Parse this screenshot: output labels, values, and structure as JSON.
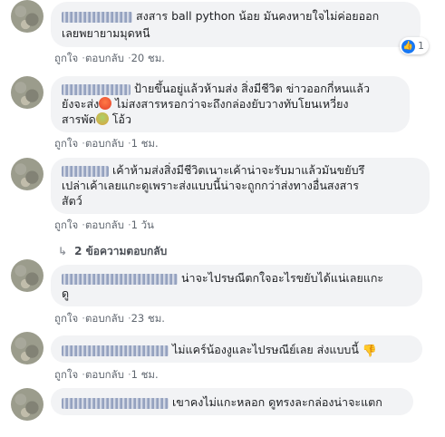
{
  "comments": [
    {
      "text_line1": "สงสาร ball python น้อย มันคงหายใจไม่ค่อยออก",
      "text_line2": "เลยพยายามมุดหนี",
      "like_label": "ถูกใจ",
      "reply_label": "ตอบกลับ",
      "time": "20 ชม.",
      "reaction_count": "1"
    },
    {
      "text_line1": "ป้ายขึ้นอยู่แล้วห้ามส่ง สิ่งมีชีวิต ข่าวออกกี่หนแล้ว",
      "text_line2a": "ยังจะส่ง",
      "text_line2b": " ไม่สงสารหรอกว่าจะถึงกล่องยับวางทับโยนเหวี่ยง",
      "text_line3a": "สารพัด",
      "text_line3b": "โอ้ว",
      "like_label": "ถูกใจ",
      "reply_label": "ตอบกลับ",
      "time": "1 ชม."
    },
    {
      "text_line1": "เค้าห้ามส่งสิ่งมีชีวิตเนาะเค้าน่าจะรับมาแล้วมันขยับรึ",
      "text_line2": "เปล่าเค้าเลยแกะดูเพราะส่งแบบนี้น่าจะถูกกว่าส่งทางอื่นสงสาร",
      "text_line3": "สัตว์",
      "like_label": "ถูกใจ",
      "reply_label": "ตอบกลับ",
      "time": "1 วัน",
      "replies_label": "2 ข้อความตอบกลับ"
    },
    {
      "text_line1": "น่าจะไปรษณีตกใจอะไรขยับได้แน่เลยแกะ",
      "text_line2": "ดู",
      "like_label": "ถูกใจ",
      "reply_label": "ตอบกลับ",
      "time": "23 ชม."
    },
    {
      "text_line1": "ไม่แคร์น้องงูและไปรษณีย์เลย ส่งแบบนี้",
      "like_label": "ถูกใจ",
      "reply_label": "ตอบกลับ",
      "time": "1 ชม."
    },
    {
      "text_line1": "เขาคงไม่แกะหลอก ดูทรงละกล่องน่าจะแตก"
    }
  ],
  "colors": {
    "bubble_bg": "#f2f3f5",
    "action_text": "#606770",
    "like_blue": "#1877f2"
  },
  "icons": [
    "like-icon",
    "angry-face-icon",
    "disgusted-face-icon",
    "reply-arrow-icon",
    "thumbs-down-icon"
  ]
}
